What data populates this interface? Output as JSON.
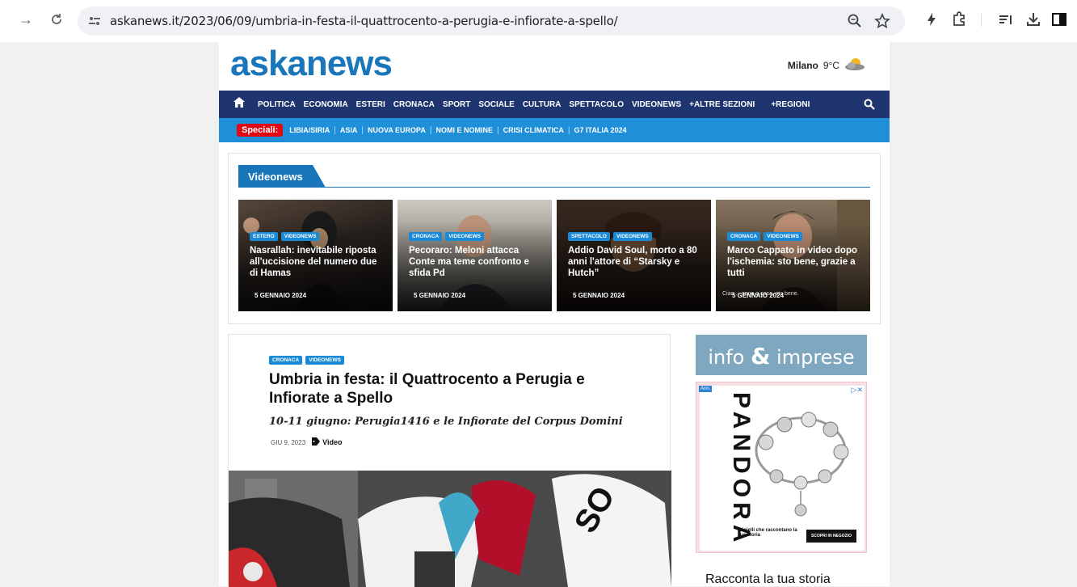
{
  "browser": {
    "url": "askanews.it/2023/06/09/umbria-in-festa-il-quattrocento-a-perugia-e-infiorate-a-spello/",
    "icons": [
      "forward-icon",
      "reload-icon",
      "site-info-icon",
      "zoom-icon",
      "bookmark-star-icon",
      "extension-bolt-icon",
      "extensions-puzzle-icon",
      "reading-list-icon",
      "download-icon",
      "side-panel-icon"
    ]
  },
  "header": {
    "logo_text": "askanews",
    "weather_city": "Milano",
    "weather_temp": "9°C"
  },
  "main_nav": {
    "items": [
      "POLITICA",
      "ECONOMIA",
      "ESTERI",
      "CRONACA",
      "SPORT",
      "SOCIALE",
      "CULTURA",
      "SPETTACOLO",
      "VIDEONEWS",
      "+ALTRE SEZIONI",
      "+REGIONI"
    ]
  },
  "sub_nav": {
    "label": "Speciali:",
    "items": [
      "LIBIA/SIRIA",
      "ASIA",
      "NUOVA EUROPA",
      "NOMI E NOMINE",
      "CRISI CLIMATICA",
      "G7 ITALIA 2024"
    ]
  },
  "videonews": {
    "tab_label": "Videonews",
    "cards": [
      {
        "tags": [
          "ESTERO",
          "VIDEONEWS"
        ],
        "title": "Nasrallah: inevitabile riposta all'uccisione del numero due di Hamas",
        "date": "5 GENNAIO 2024",
        "overlay": ""
      },
      {
        "tags": [
          "CRONACA",
          "VIDEONEWS"
        ],
        "title": "Pecoraro: Meloni attacca Conte ma teme confronto e sfida Pd",
        "date": "5 GENNAIO 2024",
        "overlay": ""
      },
      {
        "tags": [
          "SPETTACOLO",
          "VIDEONEWS"
        ],
        "title": "Addio David Soul, morto a 80 anni l'attore di “Starsky e Hutch”",
        "date": "5 GENNAIO 2024",
        "overlay": ""
      },
      {
        "tags": [
          "CRONACA",
          "VIDEONEWS"
        ],
        "title": "Marco Cappato in video dopo l'ischemia: sto bene, grazie a tutti",
        "date": "5 GENNAIO 2024",
        "overlay": "Ciao ... sono a casa, sto bene."
      }
    ]
  },
  "article": {
    "tags": [
      "CRONACA",
      "VIDEONEWS"
    ],
    "title": "Umbria in festa: il Quattrocento a Perugia e Infiorate a Spello",
    "subtitle": "10-11 giugno: Perugia1416 e le Infiorate del Corpus Domini",
    "date": "GIU 9, 2023",
    "category": "Video"
  },
  "sidebar": {
    "banner_left": "info",
    "banner_amp": "&",
    "banner_right": "imprese",
    "ad": {
      "label": "Ann.",
      "brand": "PANDORA",
      "caption": "Gioielli che raccontano la tua storia",
      "cta": "SCOPRI IN NEGOZIO"
    },
    "racconta": "Racconta la tua storia"
  }
}
